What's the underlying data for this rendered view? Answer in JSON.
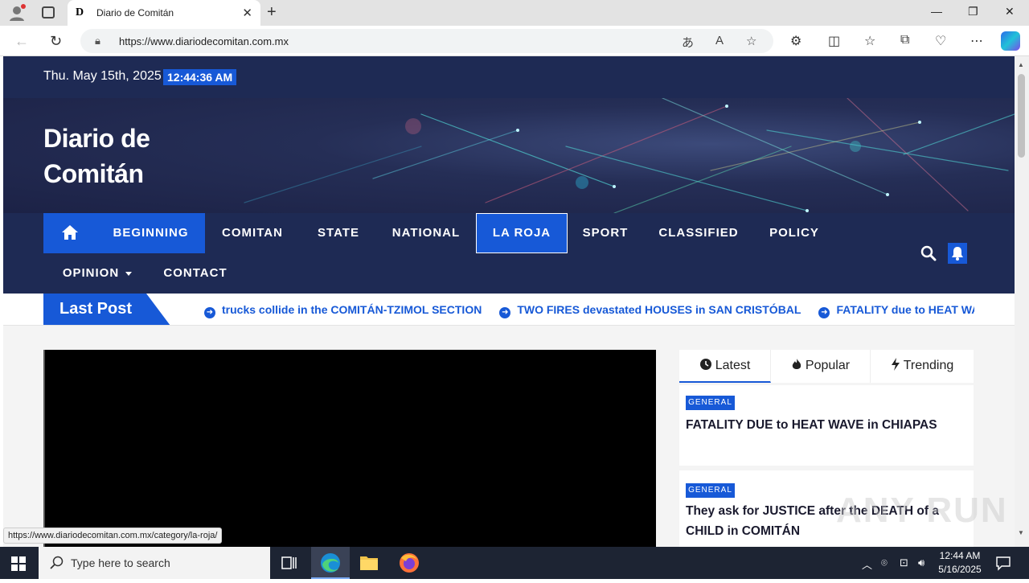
{
  "browser": {
    "tab_title": "Diario de Comitán",
    "favicon_letter": "D",
    "url": "https://www.diariodecomitan.com.mx",
    "status_url": "https://www.diariodecomitan.com.mx/category/la-roja/"
  },
  "site": {
    "date": "Thu. May 15th, 2025",
    "time": "12:44:36 AM",
    "title_line1": "Diario de",
    "title_line2": "Comitán"
  },
  "nav": {
    "items": [
      "BEGINNING",
      "COMITAN",
      "STATE",
      "NATIONAL",
      "LA ROJA",
      "SPORT",
      "CLASSIFIED",
      "POLICY"
    ],
    "row2": [
      "OPINION",
      "CONTACT"
    ]
  },
  "ticker": {
    "label": "Last Post",
    "items": [
      "trucks collide in the COMITÁN-TZIMOL SECTION",
      "TWO FIRES devastated HOUSES in SAN CRISTÓBAL",
      "FATALITY due to HEAT WAVE in CHIAPAS"
    ]
  },
  "sidebar": {
    "tabs": [
      "Latest",
      "Popular",
      "Trending"
    ],
    "posts": [
      {
        "badge": "GENERAL",
        "title": "FATALITY DUE to HEAT WAVE in CHIAPAS"
      },
      {
        "badge": "GENERAL",
        "title": "They ask for JUSTICE after the DEATH of a CHILD in COMITÁN"
      }
    ]
  },
  "watermark": "ANY RUN",
  "taskbar": {
    "search_placeholder": "Type here to search",
    "time": "12:44 AM",
    "date": "5/16/2025"
  },
  "colors": {
    "brand_blue": "#1759d7",
    "navy": "#1e2a54"
  }
}
